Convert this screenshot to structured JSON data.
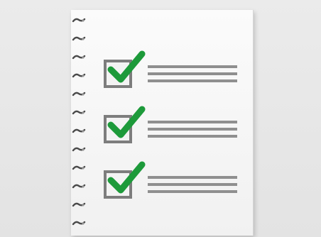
{
  "illustration": {
    "subject": "checklist",
    "colors": {
      "background": "#e6e6e6",
      "paper": "#f6f6f6",
      "checkbox_border": "#7d7d7d",
      "check_mark": "#1d9a3a",
      "text_lines": "#8f8f8f",
      "spiral": "#4a4a4a"
    },
    "spiral_rings": 12,
    "items": [
      {
        "checked": true,
        "icon": "check-icon"
      },
      {
        "checked": true,
        "icon": "check-icon"
      },
      {
        "checked": true,
        "icon": "check-icon"
      }
    ]
  }
}
